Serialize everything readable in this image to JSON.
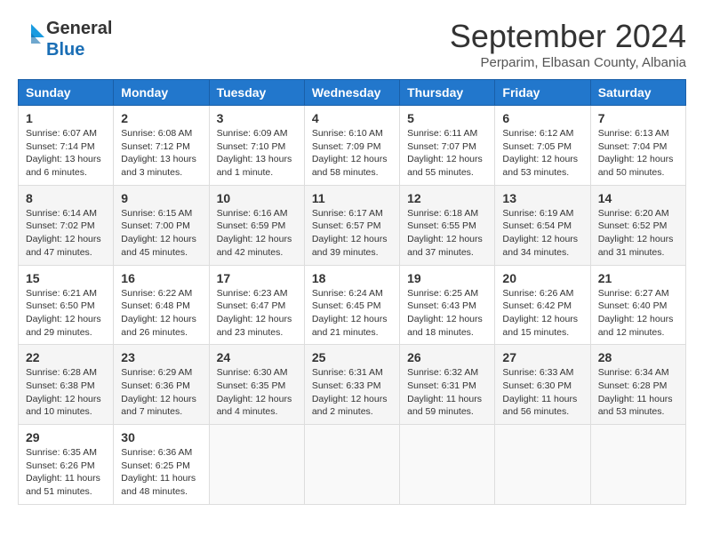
{
  "header": {
    "logo_general": "General",
    "logo_blue": "Blue",
    "month_title": "September 2024",
    "subtitle": "Perparim, Elbasan County, Albania"
  },
  "days_of_week": [
    "Sunday",
    "Monday",
    "Tuesday",
    "Wednesday",
    "Thursday",
    "Friday",
    "Saturday"
  ],
  "weeks": [
    [
      {
        "day": "1",
        "sunrise": "6:07 AM",
        "sunset": "7:14 PM",
        "daylight": "13 hours and 6 minutes."
      },
      {
        "day": "2",
        "sunrise": "6:08 AM",
        "sunset": "7:12 PM",
        "daylight": "13 hours and 3 minutes."
      },
      {
        "day": "3",
        "sunrise": "6:09 AM",
        "sunset": "7:10 PM",
        "daylight": "13 hours and 1 minute."
      },
      {
        "day": "4",
        "sunrise": "6:10 AM",
        "sunset": "7:09 PM",
        "daylight": "12 hours and 58 minutes."
      },
      {
        "day": "5",
        "sunrise": "6:11 AM",
        "sunset": "7:07 PM",
        "daylight": "12 hours and 55 minutes."
      },
      {
        "day": "6",
        "sunrise": "6:12 AM",
        "sunset": "7:05 PM",
        "daylight": "12 hours and 53 minutes."
      },
      {
        "day": "7",
        "sunrise": "6:13 AM",
        "sunset": "7:04 PM",
        "daylight": "12 hours and 50 minutes."
      }
    ],
    [
      {
        "day": "8",
        "sunrise": "6:14 AM",
        "sunset": "7:02 PM",
        "daylight": "12 hours and 47 minutes."
      },
      {
        "day": "9",
        "sunrise": "6:15 AM",
        "sunset": "7:00 PM",
        "daylight": "12 hours and 45 minutes."
      },
      {
        "day": "10",
        "sunrise": "6:16 AM",
        "sunset": "6:59 PM",
        "daylight": "12 hours and 42 minutes."
      },
      {
        "day": "11",
        "sunrise": "6:17 AM",
        "sunset": "6:57 PM",
        "daylight": "12 hours and 39 minutes."
      },
      {
        "day": "12",
        "sunrise": "6:18 AM",
        "sunset": "6:55 PM",
        "daylight": "12 hours and 37 minutes."
      },
      {
        "day": "13",
        "sunrise": "6:19 AM",
        "sunset": "6:54 PM",
        "daylight": "12 hours and 34 minutes."
      },
      {
        "day": "14",
        "sunrise": "6:20 AM",
        "sunset": "6:52 PM",
        "daylight": "12 hours and 31 minutes."
      }
    ],
    [
      {
        "day": "15",
        "sunrise": "6:21 AM",
        "sunset": "6:50 PM",
        "daylight": "12 hours and 29 minutes."
      },
      {
        "day": "16",
        "sunrise": "6:22 AM",
        "sunset": "6:48 PM",
        "daylight": "12 hours and 26 minutes."
      },
      {
        "day": "17",
        "sunrise": "6:23 AM",
        "sunset": "6:47 PM",
        "daylight": "12 hours and 23 minutes."
      },
      {
        "day": "18",
        "sunrise": "6:24 AM",
        "sunset": "6:45 PM",
        "daylight": "12 hours and 21 minutes."
      },
      {
        "day": "19",
        "sunrise": "6:25 AM",
        "sunset": "6:43 PM",
        "daylight": "12 hours and 18 minutes."
      },
      {
        "day": "20",
        "sunrise": "6:26 AM",
        "sunset": "6:42 PM",
        "daylight": "12 hours and 15 minutes."
      },
      {
        "day": "21",
        "sunrise": "6:27 AM",
        "sunset": "6:40 PM",
        "daylight": "12 hours and 12 minutes."
      }
    ],
    [
      {
        "day": "22",
        "sunrise": "6:28 AM",
        "sunset": "6:38 PM",
        "daylight": "12 hours and 10 minutes."
      },
      {
        "day": "23",
        "sunrise": "6:29 AM",
        "sunset": "6:36 PM",
        "daylight": "12 hours and 7 minutes."
      },
      {
        "day": "24",
        "sunrise": "6:30 AM",
        "sunset": "6:35 PM",
        "daylight": "12 hours and 4 minutes."
      },
      {
        "day": "25",
        "sunrise": "6:31 AM",
        "sunset": "6:33 PM",
        "daylight": "12 hours and 2 minutes."
      },
      {
        "day": "26",
        "sunrise": "6:32 AM",
        "sunset": "6:31 PM",
        "daylight": "11 hours and 59 minutes."
      },
      {
        "day": "27",
        "sunrise": "6:33 AM",
        "sunset": "6:30 PM",
        "daylight": "11 hours and 56 minutes."
      },
      {
        "day": "28",
        "sunrise": "6:34 AM",
        "sunset": "6:28 PM",
        "daylight": "11 hours and 53 minutes."
      }
    ],
    [
      {
        "day": "29",
        "sunrise": "6:35 AM",
        "sunset": "6:26 PM",
        "daylight": "11 hours and 51 minutes."
      },
      {
        "day": "30",
        "sunrise": "6:36 AM",
        "sunset": "6:25 PM",
        "daylight": "11 hours and 48 minutes."
      },
      null,
      null,
      null,
      null,
      null
    ]
  ],
  "labels": {
    "sunrise": "Sunrise:",
    "sunset": "Sunset:",
    "daylight": "Daylight:"
  }
}
